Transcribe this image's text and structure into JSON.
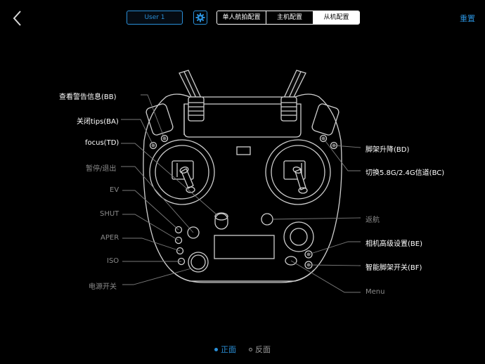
{
  "header": {
    "user_value": "User 1",
    "tabs": [
      {
        "label": "单人航拍配置",
        "active": false
      },
      {
        "label": "主机配置",
        "active": false
      },
      {
        "label": "从机配置",
        "active": true
      }
    ],
    "reset_label": "重置"
  },
  "labels": {
    "check_warning": "查看警告信息(BB)",
    "close_tips": "关闭tips(BA)",
    "focus": "focus(TD)",
    "pause_exit": "暂停/退出",
    "ev": "EV",
    "shut": "SHUT",
    "aper": "APER",
    "iso": "ISO",
    "power": "电源开关",
    "gear_lift": "脚架升降(BD)",
    "switch_channel": "切换5.8G/2.4G信道(BC)",
    "return_home": "返航",
    "camera_advanced": "相机高级设置(BE)",
    "smart_gear": "智能脚架开关(BF)",
    "menu": "Menu"
  },
  "pager": {
    "front": "正面",
    "back": "反面"
  },
  "colors": {
    "accent": "#2a8fd8",
    "background": "#000000",
    "outline": "#cfcfcf",
    "muted_label": "#8a8a8a"
  }
}
